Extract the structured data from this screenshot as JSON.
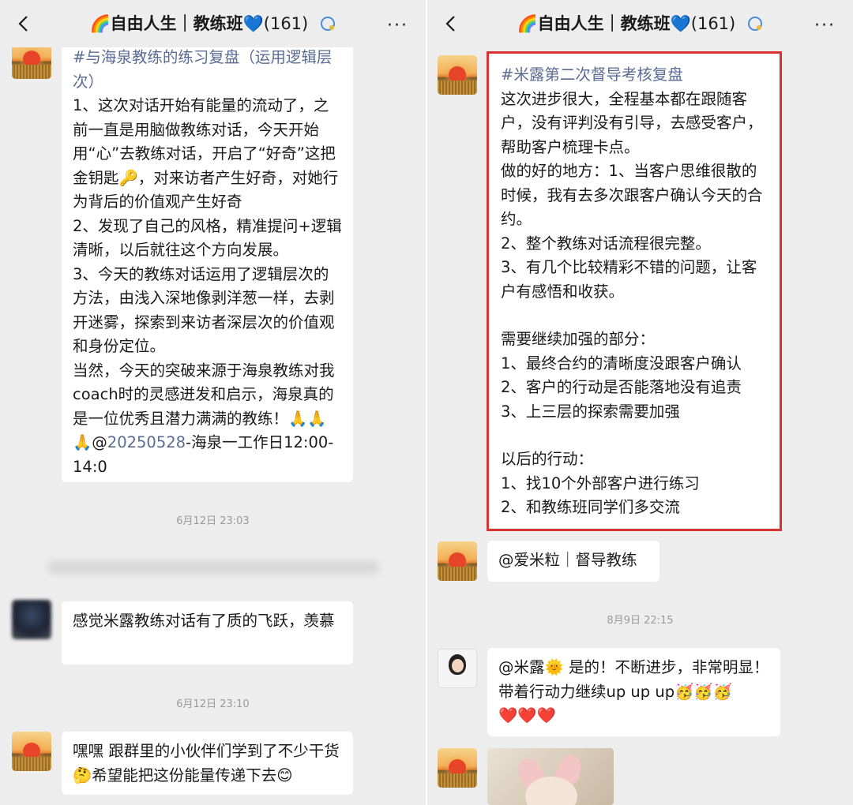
{
  "chat": {
    "title_emoji": "🌈",
    "title": "自由人生｜教练班",
    "title_heart": "💙",
    "member_count": "(161)",
    "more_label": "···"
  },
  "left": {
    "msg1": {
      "tag": "#与海泉教练的练习复盘（运用逻辑层次）",
      "lines": [
        "1、这次对话开始有能量的流动了，之前一直是用脑做教练对话，今天开始用“心”去教练对话，开启了“好奇”这把金钥匙🔑，对来访者产生好奇，对她行为背后的价值观产生好奇",
        "2、发现了自己的风格，精准提问+逻辑清晰，以后就往这个方向发展。",
        "3、今天的教练对话运用了逻辑层次的方法，由浅入深地像剥洋葱一样，去剥开迷雾，探索到来访者深层次的价值观和身份定位。"
      ],
      "closing_pre": "当然，今天的突破来源于海泉教练对我coach时的灵感迸发和启示，海泉真的是一位优秀且潜力满满的教练！🙏🙏🙏@",
      "closing_link": "20250528",
      "closing_post": "-海泉一工作日12:00-14:0"
    },
    "time1": "6月12日 23:03",
    "msg2": "感觉米露教练对话有了质的飞跃，羡慕",
    "time2": "6月12日 23:10",
    "msg3": "嘿嘿 跟群里的小伙伴们学到了不少干货🤔希望能把这份能量传递下去😊"
  },
  "right": {
    "msg1": {
      "tag": "#米露第二次督导考核复盘",
      "intro": "这次进步很大，全程基本都在跟随客户，没有评判没有引导，去感受客户，帮助客户梳理卡点。",
      "good": [
        "做的好的地方：1、当客户思维很散的时候，我有去多次跟客户确认今天的合约。",
        "2、整个教练对话流程很完整。",
        "3、有几个比较精彩不错的问题，让客户有感悟和收获。"
      ],
      "improve_title": "需要继续加强的部分：",
      "improve": [
        "1、最终合约的清晰度没跟客户确认",
        "2、客户的行动是否能落地没有追责",
        "3、上三层的探索需要加强"
      ],
      "actions_title": "以后的行动：",
      "actions": [
        "1、找10个外部客户进行练习",
        "2、和教练班同学们多交流"
      ]
    },
    "msg2": "@爱米粒｜督导教练",
    "time1": "8月9日 22:15",
    "msg3_pre": "@米露🌞 是的！不断进步，非常明显！带着行动力继续up up up🥳🥳🥳",
    "msg3_hearts": "❤️❤️❤️"
  }
}
